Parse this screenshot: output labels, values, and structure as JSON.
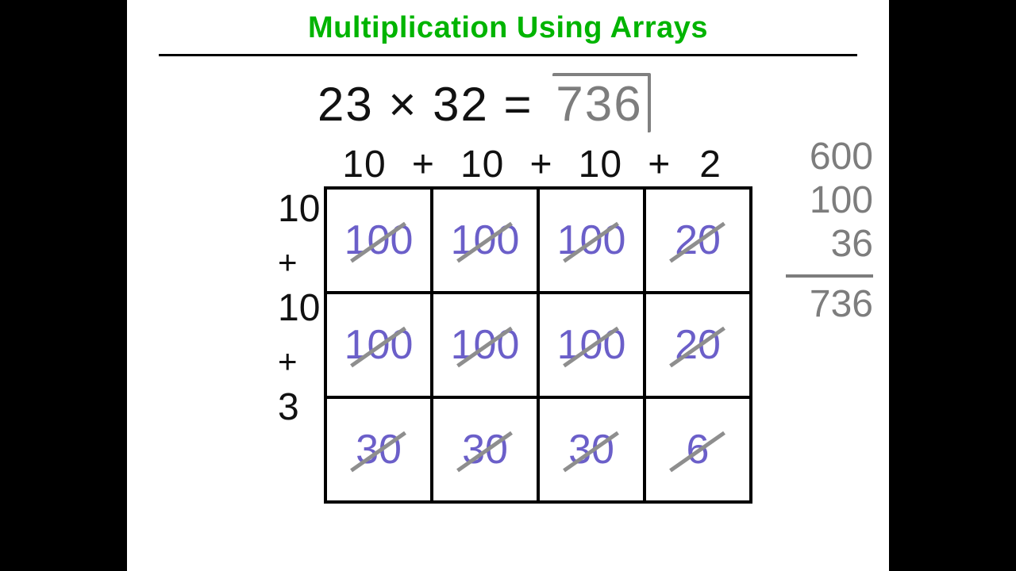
{
  "title": "Multiplication Using Arrays",
  "equation": {
    "lhs": "23 × 32",
    "eq": "=",
    "result": "736"
  },
  "column_headers": [
    "10",
    "+",
    "10",
    "+",
    "10",
    "+",
    "2"
  ],
  "row_headers": [
    "10",
    "+",
    "10",
    "+",
    "3"
  ],
  "grid": [
    [
      "100",
      "100",
      "100",
      "20"
    ],
    [
      "100",
      "100",
      "100",
      "20"
    ],
    [
      "30",
      "30",
      "30",
      "6"
    ]
  ],
  "sum": {
    "addends": [
      "600",
      "100",
      "36"
    ],
    "total": "736"
  }
}
